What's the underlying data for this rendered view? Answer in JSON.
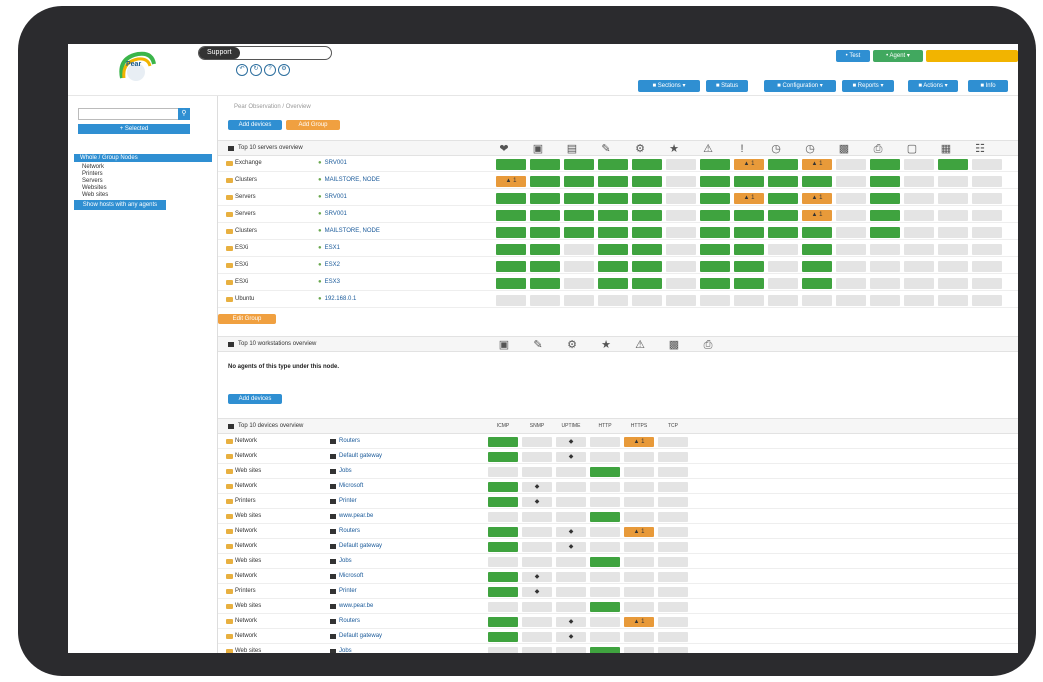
{
  "topbar": {
    "logo_text": "Pear",
    "search_label": "Support",
    "buttons_top": [
      "• Test",
      "• Agent ▾"
    ],
    "nav_buttons": [
      "■ Sections ▾",
      "■ Status",
      "■ Configuration ▾",
      "■ Reports ▾",
      "■ Actions ▾",
      "■ Info"
    ]
  },
  "sidebar": {
    "filter_button": "+ Selected",
    "tree_head": "Whole / Group Nodes",
    "tree_items": [
      "Network",
      "Printers",
      "Servers",
      "Websites",
      "Web sites"
    ],
    "action_button": "Show hosts with any agents"
  },
  "main": {
    "breadcrumb": "Pear Observation / Overview",
    "top_buttons": [
      "Add devices",
      "Add Group"
    ],
    "servers": {
      "title": "Top 10 servers overview",
      "rows": [
        {
          "group": "Exchange",
          "name": "SRV001",
          "cells": [
            "G",
            "G",
            "G",
            "G",
            "G",
            "E",
            "G",
            "O",
            "G",
            "O",
            "E",
            "G",
            "E",
            "G",
            "E"
          ]
        },
        {
          "group": "Clusters",
          "name": "MAILSTORE, NODE",
          "cells": [
            "O",
            "G",
            "G",
            "G",
            "G",
            "E",
            "G",
            "G",
            "G",
            "G",
            "E",
            "G",
            "E",
            "E",
            "E"
          ]
        },
        {
          "group": "Servers",
          "name": "SRV001",
          "cells": [
            "G",
            "G",
            "G",
            "G",
            "G",
            "E",
            "G",
            "O",
            "G",
            "O",
            "E",
            "G",
            "E",
            "E",
            "E"
          ]
        },
        {
          "group": "Servers",
          "name": "SRV001",
          "cells": [
            "G",
            "G",
            "G",
            "G",
            "G",
            "E",
            "G",
            "G",
            "G",
            "O",
            "E",
            "G",
            "E",
            "E",
            "E"
          ]
        },
        {
          "group": "Clusters",
          "name": "MAILSTORE, NODE",
          "cells": [
            "G",
            "G",
            "G",
            "G",
            "G",
            "E",
            "G",
            "G",
            "G",
            "G",
            "E",
            "G",
            "E",
            "E",
            "E"
          ]
        },
        {
          "group": "ESXi",
          "name": "ESX1",
          "cells": [
            "G",
            "G",
            "E",
            "G",
            "G",
            "E",
            "G",
            "G",
            "E",
            "G",
            "E",
            "E",
            "E",
            "E",
            "E"
          ]
        },
        {
          "group": "ESXi",
          "name": "ESX2",
          "cells": [
            "G",
            "G",
            "E",
            "G",
            "G",
            "E",
            "G",
            "G",
            "E",
            "G",
            "E",
            "E",
            "E",
            "E",
            "E"
          ]
        },
        {
          "group": "ESXi",
          "name": "ESX3",
          "cells": [
            "G",
            "G",
            "E",
            "G",
            "G",
            "E",
            "G",
            "G",
            "E",
            "G",
            "E",
            "E",
            "E",
            "E",
            "E"
          ]
        },
        {
          "group": "Ubuntu",
          "name": "192.168.0.1",
          "cells": [
            "E",
            "E",
            "E",
            "E",
            "E",
            "E",
            "E",
            "E",
            "E",
            "E",
            "E",
            "E",
            "E",
            "E",
            "E"
          ]
        }
      ],
      "alert_label": "▲ 1",
      "more_button": "Edit Group"
    },
    "workstations": {
      "title": "Top 10 workstations overview",
      "empty_text": "No agents of this type under this node.",
      "add_button": "Add devices"
    },
    "devices": {
      "title": "Top 10 devices overview",
      "columns": [
        "ICMP",
        "SNMP",
        "UPTIME",
        "HTTP",
        "HTTPS",
        "TCP"
      ],
      "rows": [
        {
          "group": "Network",
          "name": "Routers",
          "cells": [
            "G",
            "E",
            "D",
            "E",
            "O",
            "E"
          ]
        },
        {
          "group": "Network",
          "name": "Default gateway",
          "cells": [
            "G",
            "E",
            "D",
            "E",
            "E",
            "E"
          ]
        },
        {
          "group": "Web sites",
          "name": "Jobs",
          "cells": [
            "E",
            "E",
            "E",
            "G",
            "E",
            "E"
          ]
        },
        {
          "group": "Network",
          "name": "Microsoft",
          "cells": [
            "G",
            "D",
            "E",
            "E",
            "E",
            "E"
          ]
        },
        {
          "group": "Printers",
          "name": "Printer",
          "cells": [
            "G",
            "D",
            "E",
            "E",
            "E",
            "E"
          ]
        },
        {
          "group": "Web sites",
          "name": "www.pear.be",
          "cells": [
            "E",
            "E",
            "E",
            "G",
            "E",
            "E"
          ]
        },
        {
          "group": "Network",
          "name": "Routers",
          "cells": [
            "G",
            "E",
            "D",
            "E",
            "O",
            "E"
          ]
        },
        {
          "group": "Network",
          "name": "Default gateway",
          "cells": [
            "G",
            "E",
            "D",
            "E",
            "E",
            "E"
          ]
        },
        {
          "group": "Web sites",
          "name": "Jobs",
          "cells": [
            "E",
            "E",
            "E",
            "G",
            "E",
            "E"
          ]
        },
        {
          "group": "Network",
          "name": "Microsoft",
          "cells": [
            "G",
            "D",
            "E",
            "E",
            "E",
            "E"
          ]
        },
        {
          "group": "Printers",
          "name": "Printer",
          "cells": [
            "G",
            "D",
            "E",
            "E",
            "E",
            "E"
          ]
        },
        {
          "group": "Web sites",
          "name": "www.pear.be",
          "cells": [
            "E",
            "E",
            "E",
            "G",
            "E",
            "E"
          ]
        },
        {
          "group": "Network",
          "name": "Routers",
          "cells": [
            "G",
            "E",
            "D",
            "E",
            "O",
            "E"
          ]
        },
        {
          "group": "Network",
          "name": "Default gateway",
          "cells": [
            "G",
            "E",
            "D",
            "E",
            "E",
            "E"
          ]
        },
        {
          "group": "Web sites",
          "name": "Jobs",
          "cells": [
            "E",
            "E",
            "E",
            "G",
            "E",
            "E"
          ]
        }
      ],
      "dot": "◆"
    }
  },
  "colors": {
    "green": "#3fa33f",
    "orange": "#e89a3a",
    "blue": "#2f8fd2",
    "empty": "#e4e4e4"
  }
}
